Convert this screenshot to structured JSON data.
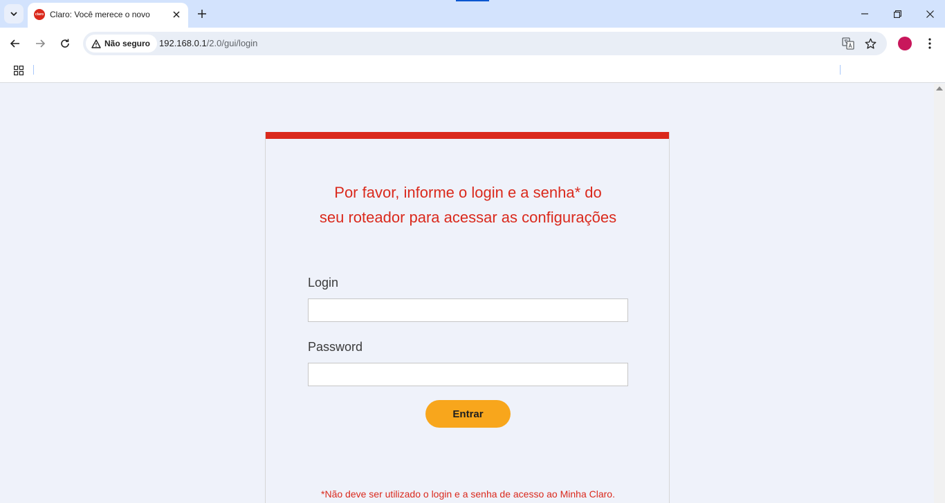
{
  "browser": {
    "tab": {
      "title": "Claro: Você merece o novo",
      "favicon_text": "claro"
    },
    "address_bar": {
      "security_label": "Não seguro",
      "url_host": "192.168.0.1",
      "url_path": "/2.0/gui/login"
    }
  },
  "page": {
    "headline_line1": "Por favor, informe o login e a senha* do",
    "headline_line2": "seu roteador para acessar as configurações",
    "login": {
      "label": "Login",
      "value": ""
    },
    "password": {
      "label": "Password",
      "value": ""
    },
    "submit_label": "Entrar",
    "footnote": "*Não deve ser utilizado o login e a senha de acesso ao Minha Claro."
  },
  "colors": {
    "brand_red": "#da291c",
    "button_orange": "#f8a61c",
    "page_background": "#eff2fa",
    "avatar": "#c8175b"
  }
}
